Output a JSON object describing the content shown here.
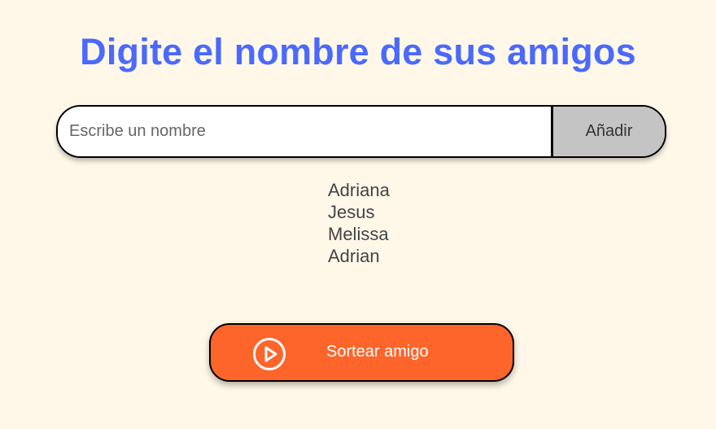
{
  "header": {
    "title": "Digite el nombre de sus amigos"
  },
  "input": {
    "placeholder": "Escribe un nombre",
    "value": "",
    "add_label": "Añadir"
  },
  "friends": [
    "Adriana",
    "Jesus",
    "Melissa",
    "Adrian"
  ],
  "draw": {
    "label": "Sortear amigo",
    "icon": "play-circle-icon"
  },
  "colors": {
    "background": "#FFF8E9",
    "title": "#4B69FD",
    "draw_button": "#FE652B",
    "add_button": "#C4C4C4"
  }
}
